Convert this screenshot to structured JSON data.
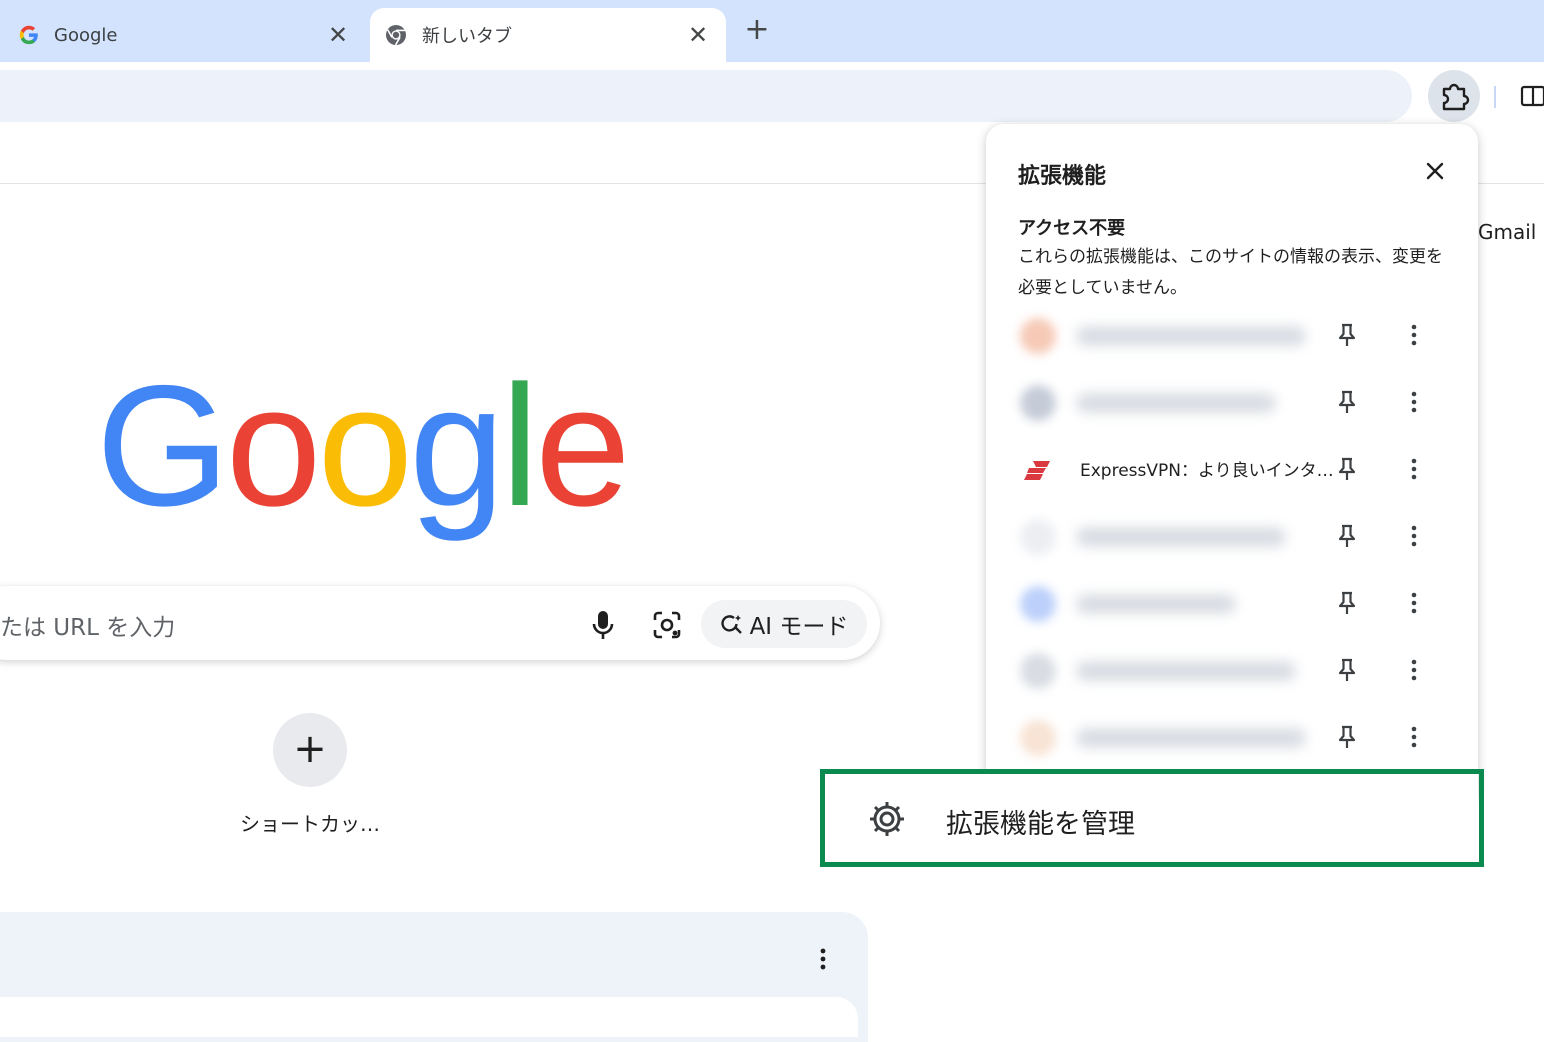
{
  "tabs": [
    {
      "title": "Google",
      "icon": "google-g-icon",
      "active": false
    },
    {
      "title": "新しいタブ",
      "icon": "chrome-icon",
      "active": true
    }
  ],
  "toolbar": {
    "extensions_icon": "puzzle-icon",
    "side_panel_icon": "side-panel-icon"
  },
  "ntp": {
    "gmail": "Gmail",
    "logo_letters": [
      {
        "ch": "G",
        "color": "#4285F4"
      },
      {
        "ch": "o",
        "color": "#EA4335"
      },
      {
        "ch": "o",
        "color": "#FBBC05"
      },
      {
        "ch": "g",
        "color": "#4285F4"
      },
      {
        "ch": "l",
        "color": "#34A853"
      },
      {
        "ch": "e",
        "color": "#EA4335"
      }
    ],
    "search_placeholder": "たは URL を入力",
    "ai_mode_label": "AI モード",
    "shortcut_label": "ショートカッ…"
  },
  "extensions_popup": {
    "title": "拡張機能",
    "section_heading": "アクセス不要",
    "section_desc": "これらの拡張機能は、このサイトの情報の表示、変更を必要としていません。",
    "items": [
      {
        "name": "",
        "blurred": true,
        "icon_color": "#f6c9b6",
        "bar_width": 230
      },
      {
        "name": "",
        "blurred": true,
        "icon_color": "#c5ccd8",
        "bar_width": 200
      },
      {
        "name": "ExpressVPN：より良いインタ…",
        "blurred": false,
        "icon_color": "#da3940",
        "bar_width": 0
      },
      {
        "name": "",
        "blurred": true,
        "icon_color": "#eceef2",
        "bar_width": 210
      },
      {
        "name": "",
        "blurred": true,
        "icon_color": "#bcd0fb",
        "bar_width": 160
      },
      {
        "name": "",
        "blurred": true,
        "icon_color": "#d9dde3",
        "bar_width": 220
      },
      {
        "name": "",
        "blurred": true,
        "icon_color": "#f8e3d4",
        "bar_width": 230
      }
    ],
    "manage_label": "拡張機能を管理",
    "highlight_color": "#0b8a4f"
  }
}
